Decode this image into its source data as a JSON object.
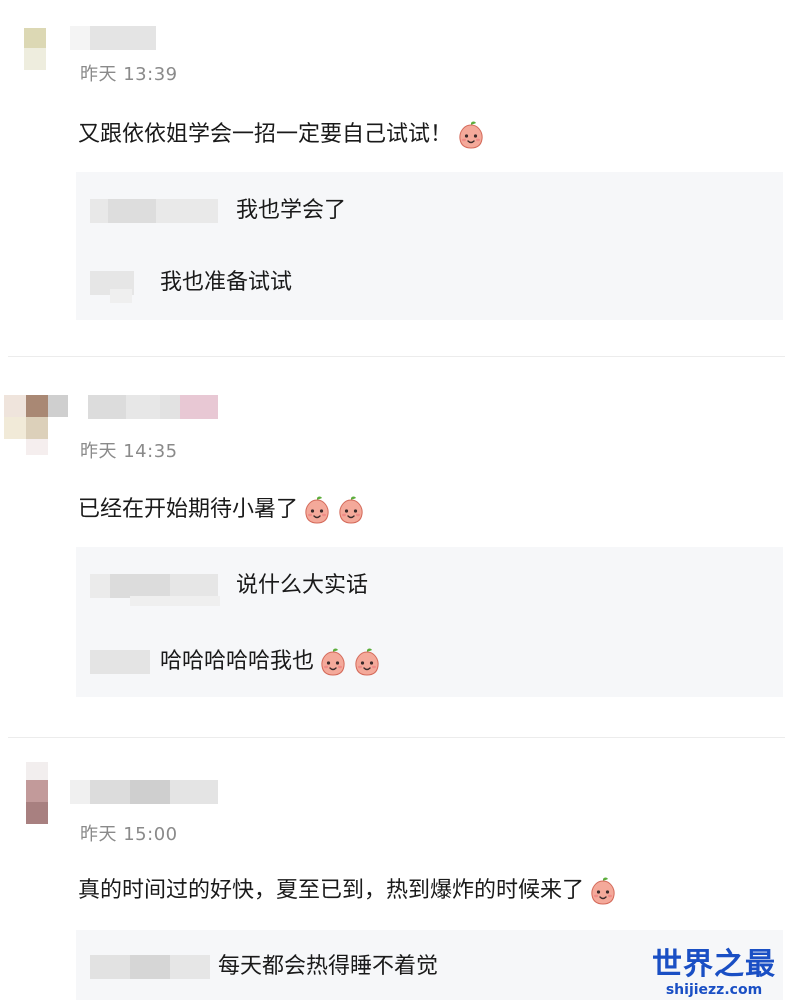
{
  "comments": [
    {
      "time": "昨天 13:39",
      "text": "又跟依依姐学会一招一定要自己试试！",
      "emoji_count": 1,
      "replies": [
        {
          "text": "我也学会了",
          "emoji_count": 0
        },
        {
          "text": "我也准备试试",
          "emoji_count": 0
        }
      ]
    },
    {
      "time": "昨天 14:35",
      "text": "已经在开始期待小暑了",
      "emoji_count": 2,
      "replies": [
        {
          "text": "说什么大实话",
          "emoji_count": 0
        },
        {
          "text": "哈哈哈哈哈我也",
          "emoji_count": 2
        }
      ]
    },
    {
      "time": "昨天 15:00",
      "text": "真的时间过的好快，夏至已到，热到爆炸的时候来了",
      "emoji_count": 1,
      "replies": [
        {
          "text": "每天都会热得睡不着觉",
          "emoji_count": 0
        }
      ]
    }
  ],
  "emoji_icon": "peach-face-emoji",
  "colors": {
    "reply_bg": "#f6f7f9",
    "time": "#8a8a8a",
    "watermark": "#1a4fc4"
  },
  "watermark": {
    "title": "世界之最",
    "url": "shijiezz.com"
  }
}
